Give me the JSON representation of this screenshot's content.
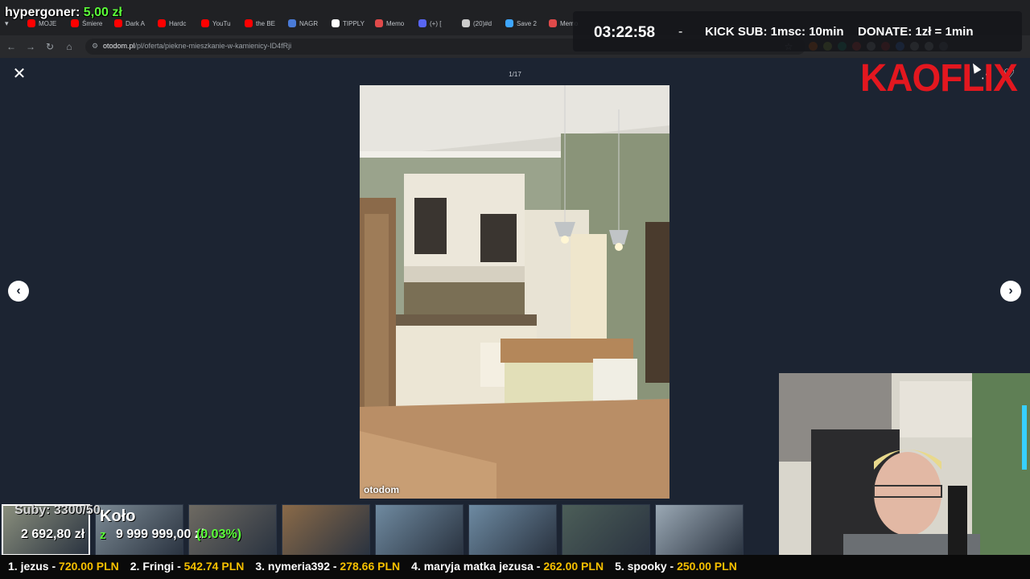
{
  "browser": {
    "tabs": [
      {
        "label": "MOJE",
        "color": "#ff0000"
      },
      {
        "label": "Śmiere",
        "color": "#ff0000"
      },
      {
        "label": "Dark A",
        "color": "#ff0000"
      },
      {
        "label": "Hardc",
        "color": "#ff0000"
      },
      {
        "label": "YouTu",
        "color": "#ff0000"
      },
      {
        "label": "the BE",
        "color": "#ff0000"
      },
      {
        "label": "NAGR",
        "color": "#4a7bd8"
      },
      {
        "label": "TIPPLY",
        "color": "#ffffff"
      },
      {
        "label": "Memo",
        "color": "#e04a4a"
      },
      {
        "label": "(+) [",
        "color": "#5865f2"
      },
      {
        "label": "(20)#d",
        "color": "#cccccc"
      },
      {
        "label": "Save 2",
        "color": "#3ea6ff"
      },
      {
        "label": "Memo",
        "color": "#e04a4a"
      }
    ],
    "url_host": "otodom.pl",
    "url_path": "/pl/oferta/piekne-mieszkanie-w-kamienicy-ID4fRji",
    "extension_colors": [
      "#ff6d00",
      "#a0c040",
      "#10a37f",
      "#e53935",
      "#9aa0a6",
      "#c62828",
      "#3b82f6",
      "#9aa0a6",
      "#9aa0a6",
      "#5f6368"
    ]
  },
  "overlay": {
    "top_donation_name": "hypergoner:",
    "top_donation_amount": "5,00 zł",
    "timer": "03:22:58",
    "timer_sep": "-",
    "kick_sub": "KICK SUB: 1msc: 10min",
    "donate": "DONATE: 1zł = 1min",
    "logo": "KAOFLIX",
    "subs": "Suby: 3300/50",
    "koto": "Koło",
    "goal_current": "2 692,80 zł",
    "goal_z": "z",
    "goal_total": "9 999 999,00 zł",
    "goal_pct": "(0.03%)",
    "ticker": [
      {
        "rank": "1. jezus - ",
        "amount": "720.00 PLN"
      },
      {
        "rank": "2. Fringi - ",
        "amount": "542.74 PLN"
      },
      {
        "rank": "3. nymeria392 - ",
        "amount": "278.66 PLN"
      },
      {
        "rank": "4. maryja matka jezusa - ",
        "amount": "262.00 PLN"
      },
      {
        "rank": "5. spooky - ",
        "amount": "250.00 PLN"
      }
    ]
  },
  "gallery": {
    "counter": "1/17",
    "watermark": "otodom",
    "thumb_colors": [
      "#8a8f7d",
      "#7c8a94",
      "#6e6a62",
      "#8a6a48",
      "#6f8aa0",
      "#6d8aa2",
      "#4c5e58",
      "#9aa8b4"
    ]
  }
}
